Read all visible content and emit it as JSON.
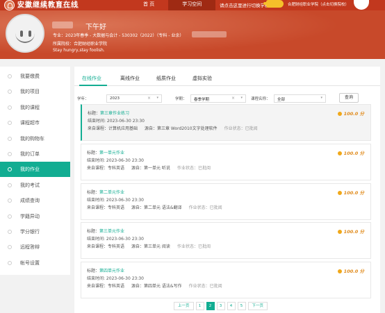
{
  "header": {
    "logo_cn": "安徽继续教育在线",
    "logo_en": "Anhui Continuing Education Online",
    "nav": [
      "首 页",
      "学习空间"
    ],
    "switch_hint": "请点击这里进行切换学校",
    "school_switch": "合肥财经职业学院（点击切换院校）"
  },
  "banner": {
    "greeting": "下午好",
    "major": "专业：2023年春季 - 大数据与会计 - 530302（2022）（专科 - 业余）",
    "college": "所属院校：合肥财经职业学院",
    "motto": "Stay hungry,stay foolish."
  },
  "sidebar": {
    "items": [
      "我要缴费",
      "我的项目",
      "我的课程",
      "课程超市",
      "我的购物车",
      "我的订单",
      "我的作业",
      "我的考试",
      "成绩查询",
      "学籍异动",
      "学分银行",
      "远程答辩",
      "帐号设置"
    ],
    "active_index": 6
  },
  "tabs": [
    "在线作业",
    "离线作业",
    "纸质作业",
    "虚拟实验"
  ],
  "filters": {
    "year_label": "学年：",
    "year_value": "2023",
    "term_label": "学期：",
    "term_value": "春季学期",
    "course_label": "课程名称：",
    "course_value": "全部",
    "query": "查询"
  },
  "cards": [
    {
      "title_label": "标题：",
      "title": "第三章作业练习",
      "deadline": "结束时间: 2023-06-30 23:30",
      "course": "来自课程：计算机应用基础",
      "source": "源自：第三章 Word2010文字处理软件",
      "status": "作业状态：已批阅",
      "score": "100.0 分"
    },
    {
      "title_label": "标题：",
      "title": "第一单元作业",
      "deadline": "结束时间: 2023-06-30 23:30",
      "course": "来自课程：专科英语",
      "source": "源自：第一单元 听说",
      "status": "作业状态：已批阅",
      "score": "100.0 分"
    },
    {
      "title_label": "标题：",
      "title": "第二单元作业",
      "deadline": "结束时间: 2023-06-30 23:30",
      "course": "来自课程：专科英语",
      "source": "源自：第二单元 语法&翻译",
      "status": "作业状态：已批阅",
      "score": "100.0 分"
    },
    {
      "title_label": "标题：",
      "title": "第三单元作业",
      "deadline": "结束时间: 2023-06-30 23:30",
      "course": "来自课程：专科英语",
      "source": "源自：第三单元 阅读",
      "status": "作业状态：已批阅",
      "score": "100.0 分"
    },
    {
      "title_label": "标题：",
      "title": "第四单元作业",
      "deadline": "结束时间: 2023-06-30 23:30",
      "course": "来自课程：专科英语",
      "source": "源自：第四单元 语法&写作",
      "status": "作业状态：已批阅",
      "score": "100.0 分"
    }
  ],
  "pager": {
    "prev": "上一页",
    "pages": [
      "1",
      "2",
      "3",
      "4",
      "5"
    ],
    "current": "2",
    "next": "下一页"
  },
  "colors": {
    "header": "#c2381e",
    "accent": "#12ad92",
    "score": "#e08a1a"
  }
}
